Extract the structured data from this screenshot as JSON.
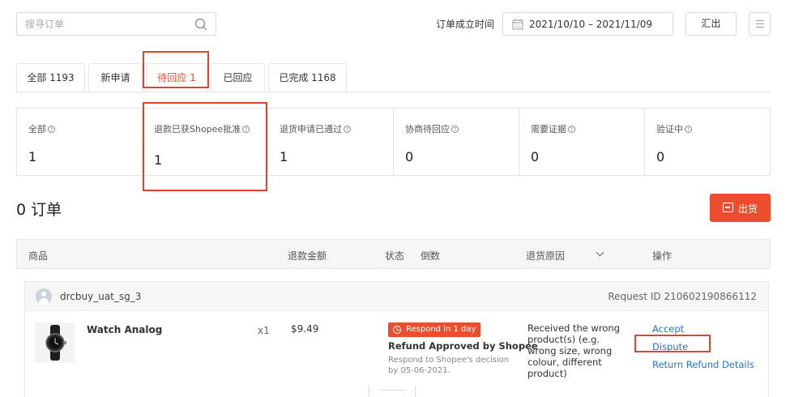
{
  "search": {
    "placeholder": "搜寻订单",
    "icon": "search-icon"
  },
  "date_filter": {
    "label": "订单成立时间",
    "range": "2021/10/10 – 2021/11/09",
    "icon": "calendar-icon"
  },
  "export_label": "汇出",
  "menu_icon": "menu-icon",
  "tabs": [
    {
      "label": "全部 1193",
      "active": false
    },
    {
      "label": "新申请",
      "active": false
    },
    {
      "label": "待回应 1",
      "active": true
    },
    {
      "label": "已回应",
      "active": false
    },
    {
      "label": "已完成 1168",
      "active": false
    }
  ],
  "stats": [
    {
      "label": "全部",
      "value": "1"
    },
    {
      "label": "退款已获Shopee批准",
      "value": "1"
    },
    {
      "label": "退货申请已通过",
      "value": "1"
    },
    {
      "label": "协商待回应",
      "value": "0"
    },
    {
      "label": "需要证据",
      "value": "0"
    },
    {
      "label": "验证中",
      "value": "0"
    }
  ],
  "orders_title": "0 订单",
  "ship_button": "出货",
  "table_headers": {
    "product": "商品",
    "refund_amount": "退款金额",
    "status": "状态",
    "countdown": "倒数",
    "return_reason": "退货原因",
    "actions": "操作"
  },
  "order": {
    "buyer": "drcbuy_uat_sg_3",
    "request_id": "Request ID 210602190866112",
    "product_name": "Watch Analog",
    "quantity": "x1",
    "price": "$9.49",
    "badge": "Respond in 1 day",
    "status_title": "Refund Approved by Shopee",
    "status_note": "Respond to Shopee's decision by 05-06-2021.",
    "reason": "Received the wrong product(s) (e.g. wrong size, wrong colour, different product)",
    "actions": [
      "Accept",
      "Dispute",
      "Return Refund Details"
    ]
  },
  "colors": {
    "accent": "#ee4d2d",
    "link": "#2673dd",
    "annotation": "#e0452c"
  }
}
